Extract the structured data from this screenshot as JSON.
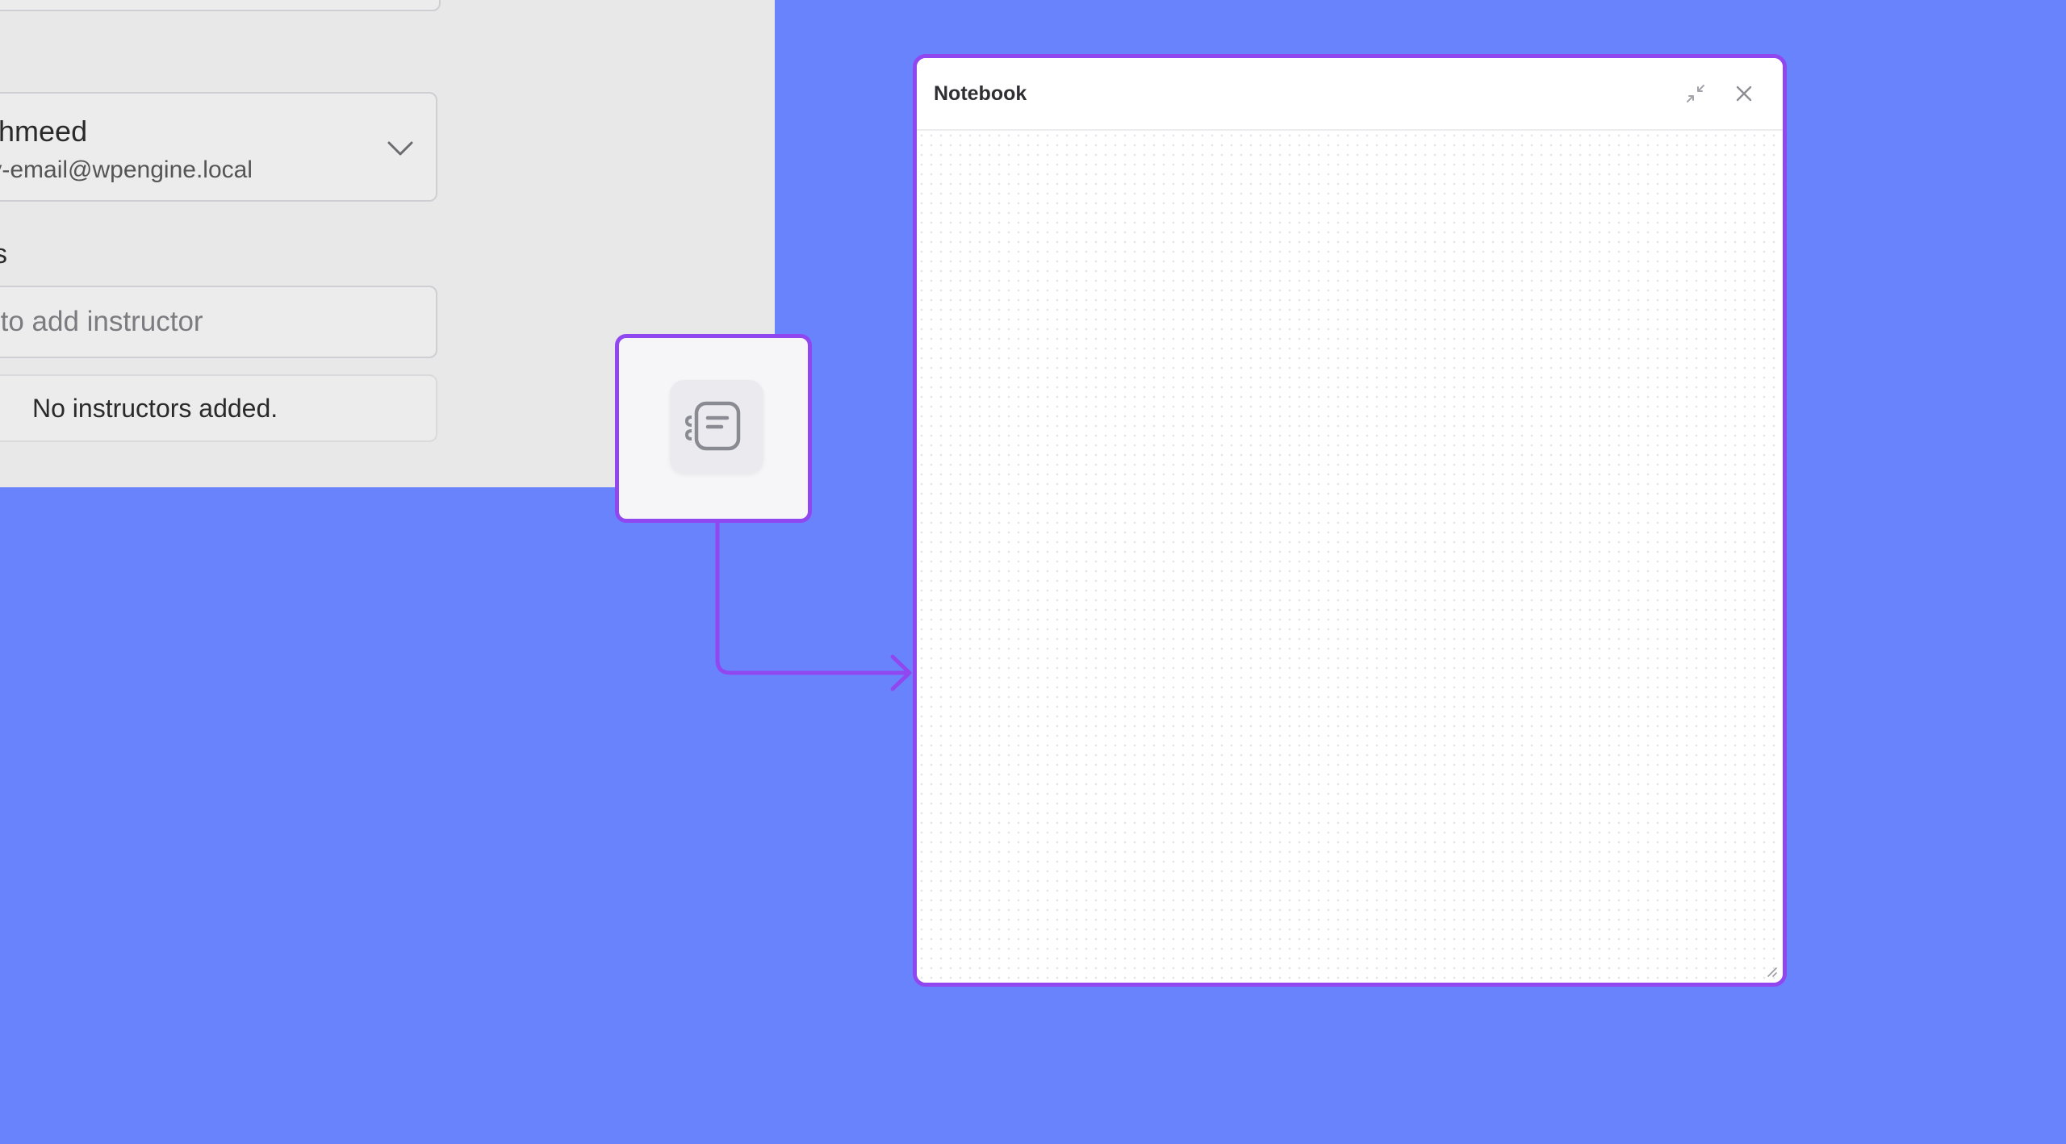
{
  "form_panel": {
    "user": {
      "name": "Tahmeed",
      "email": "dev-email@wpengine.local"
    },
    "instructors": {
      "label": "s",
      "search_placeholder": "Search to add instructor",
      "empty_message": "No instructors added."
    }
  },
  "node": {
    "icon": "notebook-icon"
  },
  "notebook": {
    "title": "Notebook",
    "minimize_icon": "minimize-icon",
    "close_icon": "close-icon",
    "content": ""
  },
  "colors": {
    "background": "#6983fd",
    "accent": "#9147f0",
    "panel": "#e8e8e8"
  }
}
